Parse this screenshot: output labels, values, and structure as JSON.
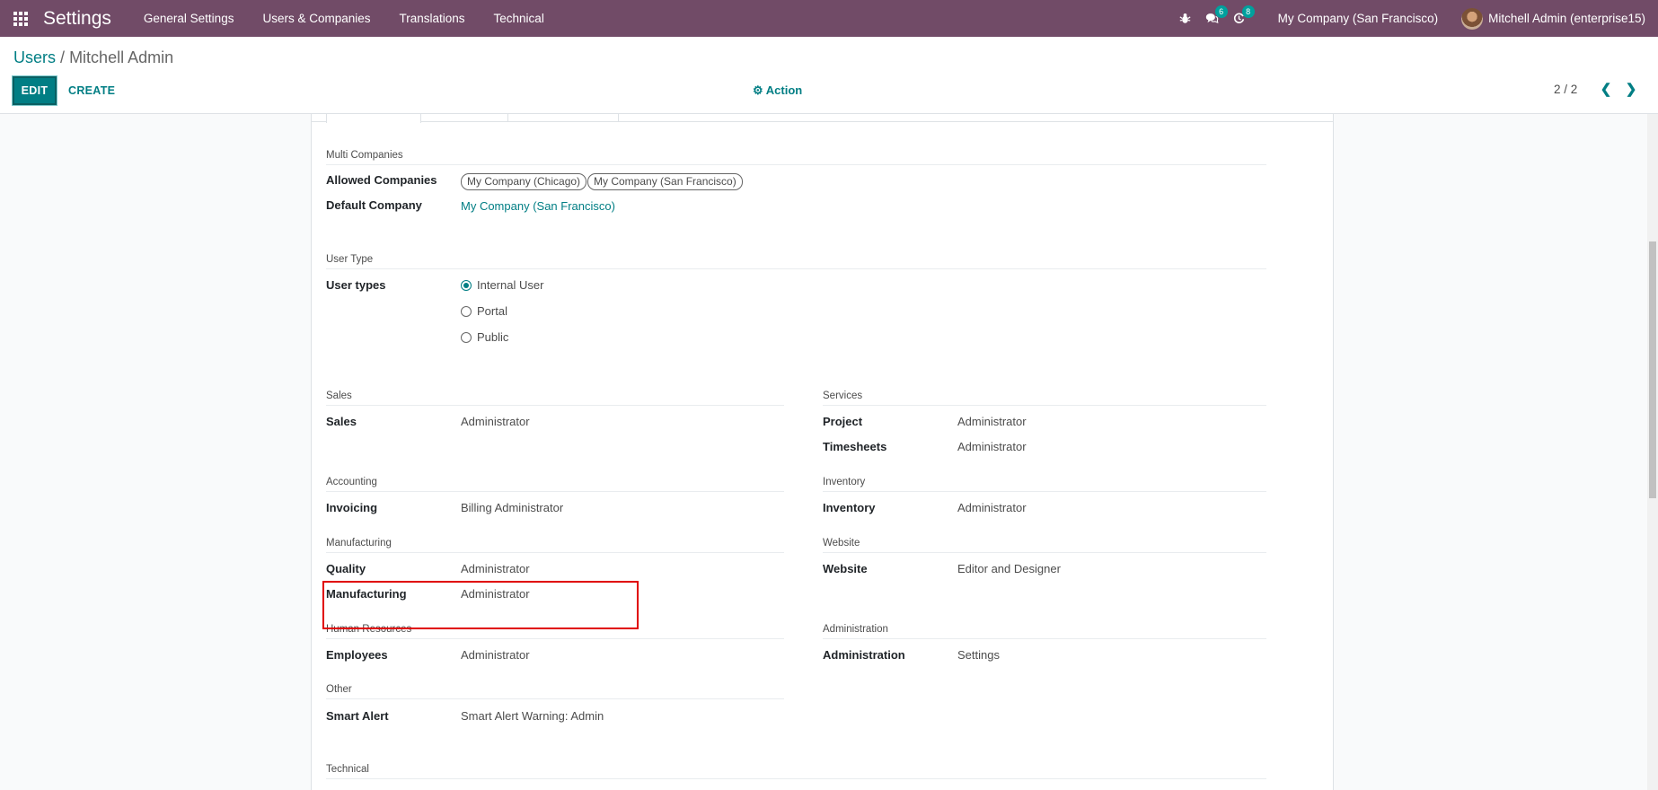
{
  "navbar": {
    "app_title": "Settings",
    "menu": [
      "General Settings",
      "Users & Companies",
      "Translations",
      "Technical"
    ],
    "debug_icon": "bug-icon",
    "messages_badge": "6",
    "activities_badge": "8",
    "company": "My Company (San Francisco)",
    "user": "Mitchell Admin (enterprise15)"
  },
  "control_panel": {
    "breadcrumb_parent": "Users",
    "breadcrumb_separator": "/",
    "breadcrumb_current": "Mitchell Admin",
    "edit_label": "EDIT",
    "create_label": "CREATE",
    "action_label": "Action",
    "pager_value": "2 / 2"
  },
  "form": {
    "multi_companies": {
      "title": "Multi Companies",
      "allowed_label": "Allowed Companies",
      "allowed_tags": [
        "My Company (Chicago)",
        "My Company (San Francisco)"
      ],
      "default_label": "Default Company",
      "default_value": "My Company (San Francisco)"
    },
    "user_type": {
      "title": "User Type",
      "label": "User types",
      "options": [
        "Internal User",
        "Portal",
        "Public"
      ],
      "selected": "Internal User"
    },
    "sales": {
      "title": "Sales",
      "label": "Sales",
      "value": "Administrator"
    },
    "services": {
      "title": "Services",
      "project_label": "Project",
      "project_value": "Administrator",
      "timesheets_label": "Timesheets",
      "timesheets_value": "Administrator"
    },
    "accounting": {
      "title": "Accounting",
      "label": "Invoicing",
      "value": "Billing Administrator"
    },
    "inventory": {
      "title": "Inventory",
      "label": "Inventory",
      "value": "Administrator"
    },
    "manufacturing": {
      "title": "Manufacturing",
      "quality_label": "Quality",
      "quality_value": "Administrator",
      "manufacturing_label": "Manufacturing",
      "manufacturing_value": "Administrator"
    },
    "website": {
      "title": "Website",
      "label": "Website",
      "value": "Editor and Designer"
    },
    "human_resources": {
      "title": "Human Resources",
      "label": "Employees",
      "value": "Administrator"
    },
    "administration": {
      "title": "Administration",
      "label": "Administration",
      "value": "Settings"
    },
    "other": {
      "title": "Other",
      "label": "Smart Alert",
      "value": "Smart Alert Warning: Admin"
    },
    "technical": {
      "title": "Technical"
    }
  },
  "colors": {
    "navbar": "#714b67",
    "accent": "#017e84",
    "highlight": "#e00000"
  }
}
